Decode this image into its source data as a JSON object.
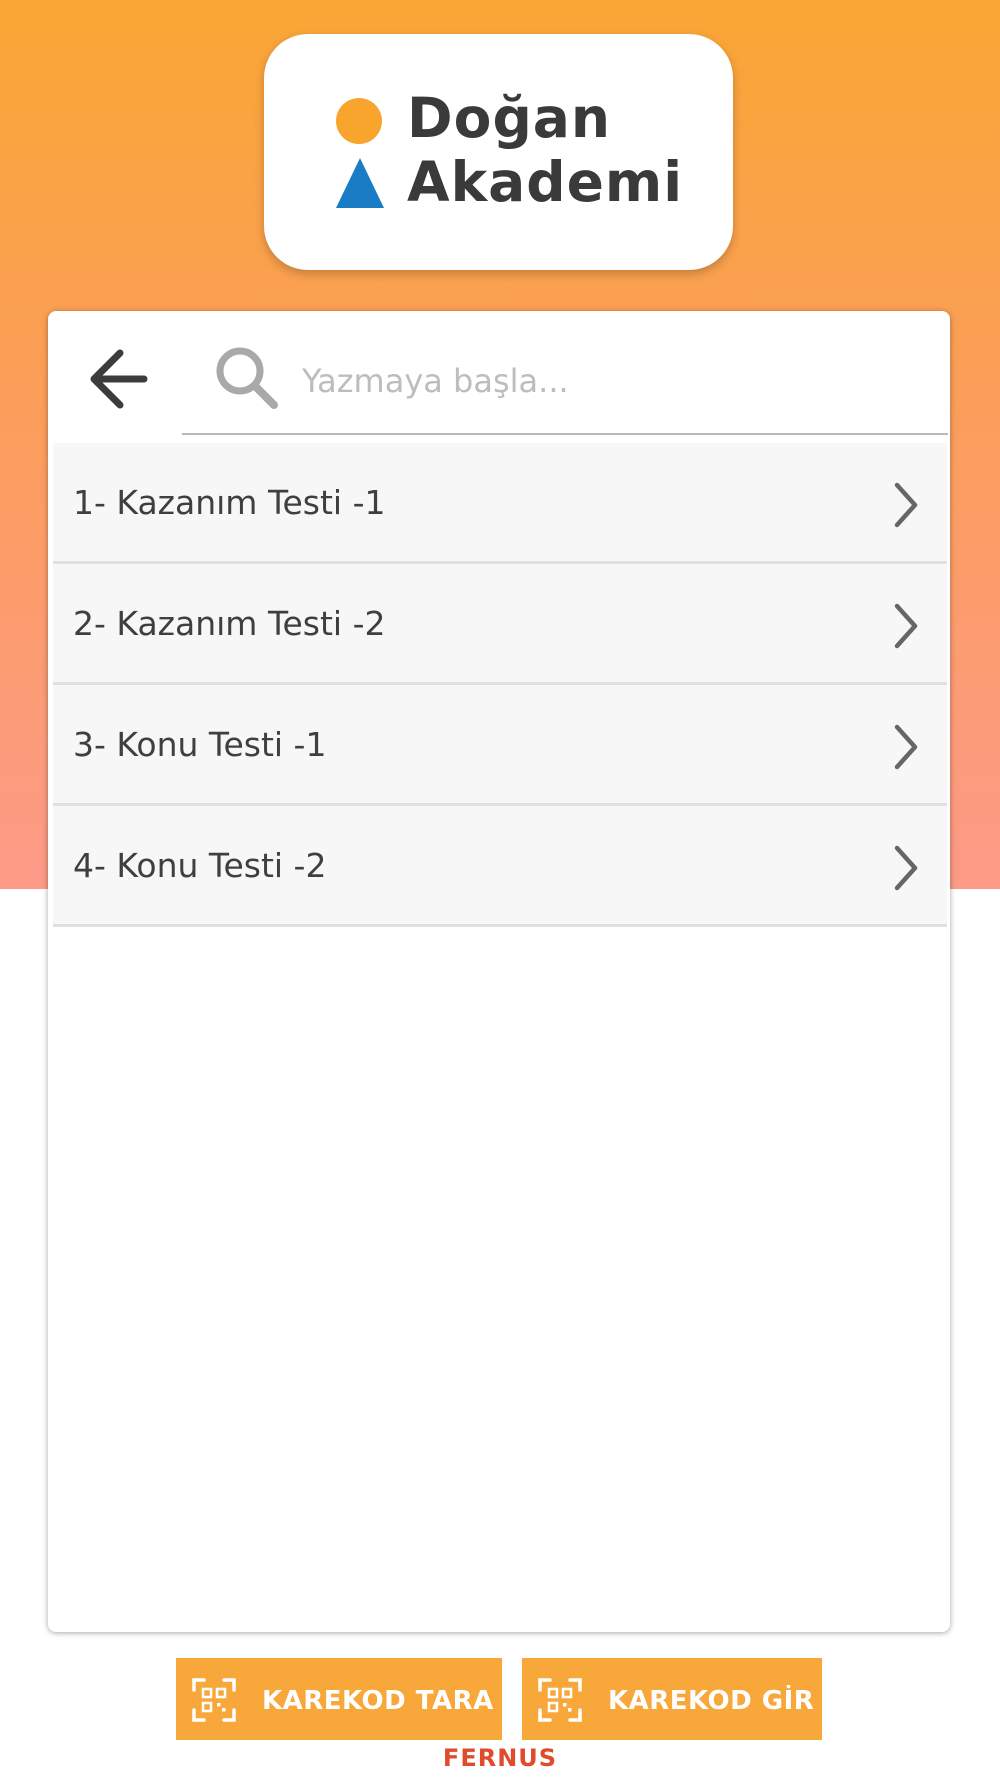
{
  "brand": {
    "logo_line1": "Doğan",
    "logo_line2": "Akademi",
    "dot_color": "#f7a52c",
    "triangle_color": "#1a7cc4"
  },
  "search": {
    "placeholder": "Yazmaya başla...",
    "value": ""
  },
  "icons": {
    "back": "arrow-left-icon",
    "search": "search-icon",
    "chevron": "chevron-right-icon",
    "qr": "qr-code-icon"
  },
  "tests": [
    {
      "label": "1- Kazanım Testi -1"
    },
    {
      "label": "2- Kazanım Testi -2"
    },
    {
      "label": "3- Konu Testi -1"
    },
    {
      "label": "4- Konu Testi -2"
    }
  ],
  "actions": {
    "scan_label": "KAREKOD TARA",
    "enter_label": "KAREKOD GİR"
  },
  "footer": {
    "brand": "FERNUS"
  },
  "colors": {
    "accent": "#f8a83a",
    "gradient_top": "#f9a634",
    "gradient_bottom": "#fd9a88",
    "footer_brand": "#e04c2b"
  }
}
